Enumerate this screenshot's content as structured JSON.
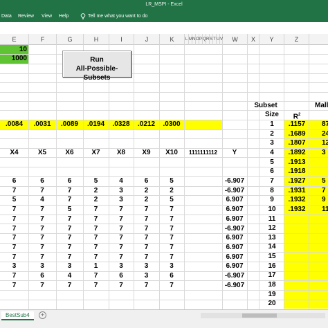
{
  "window": {
    "title": "LR_MSPI  -  Excel"
  },
  "menu": {
    "items": [
      "Data",
      "Review",
      "View",
      "Help"
    ],
    "tell_me": "Tell me what you want to do"
  },
  "columns": [
    "E",
    "F",
    "G",
    "H",
    "I",
    "J",
    "K",
    "L",
    "M",
    "N",
    "O",
    "P",
    "Q",
    "R",
    "S",
    "T",
    "U",
    "V",
    "W",
    "X",
    "Y",
    "Z"
  ],
  "colors": {
    "excel_green": "#217346",
    "cell_green": "#5ec432",
    "highlight_yellow": "#ffff00"
  },
  "sheet": {
    "cell_e1": "10",
    "cell_e2": "1000",
    "run_button": {
      "line1": "Run",
      "line2": "All-Possible-Subsets"
    },
    "prob_row": [
      ".0084",
      ".0031",
      ".0089",
      ".0194",
      ".0328",
      ".0212",
      ".0300"
    ],
    "headers": [
      "X4",
      "X5",
      "X6",
      "X7",
      "X8",
      "X9",
      "X10",
      "1111111112",
      "Y"
    ],
    "data_rows": [
      [
        "6",
        "6",
        "6",
        "5",
        "4",
        "6",
        "5",
        "-6.907"
      ],
      [
        "7",
        "7",
        "7",
        "2",
        "3",
        "2",
        "2",
        "-6.907"
      ],
      [
        "5",
        "4",
        "7",
        "2",
        "3",
        "2",
        "5",
        "6.907"
      ],
      [
        "7",
        "7",
        "5",
        "7",
        "7",
        "7",
        "7",
        "6.907"
      ],
      [
        "7",
        "7",
        "7",
        "7",
        "7",
        "7",
        "7",
        "6.907"
      ],
      [
        "7",
        "7",
        "7",
        "7",
        "7",
        "7",
        "7",
        "-6.907"
      ],
      [
        "7",
        "7",
        "7",
        "7",
        "7",
        "7",
        "7",
        "6.907"
      ],
      [
        "7",
        "7",
        "7",
        "7",
        "7",
        "7",
        "7",
        "6.907"
      ],
      [
        "7",
        "7",
        "7",
        "7",
        "7",
        "7",
        "7",
        "6.907"
      ],
      [
        "3",
        "3",
        "3",
        "1",
        "3",
        "3",
        "3",
        "6.907"
      ],
      [
        "7",
        "6",
        "4",
        "7",
        "6",
        "3",
        "6",
        "-6.907"
      ],
      [
        "7",
        "7",
        "7",
        "7",
        "7",
        "7",
        "7",
        "-6.907"
      ]
    ],
    "subset_header": {
      "line1": "Subset",
      "line2": "Size",
      "r2": "R",
      "r2_sup": "2",
      "mal_partial": "Mall"
    },
    "subset_rows": [
      {
        "size": "1",
        "r2": ".1157",
        "mal": "87"
      },
      {
        "size": "2",
        "r2": ".1689",
        "mal": "24"
      },
      {
        "size": "3",
        "r2": ".1807",
        "mal": "12"
      },
      {
        "size": "4",
        "r2": ".1892",
        "mal": "3"
      },
      {
        "size": "5",
        "r2": ".1913",
        "mal": ""
      },
      {
        "size": "6",
        "r2": ".1918",
        "mal": ""
      },
      {
        "size": "7",
        "r2": ".1927",
        "mal": "5"
      },
      {
        "size": "8",
        "r2": ".1931",
        "mal": "7"
      },
      {
        "size": "9",
        "r2": ".1932",
        "mal": "9"
      },
      {
        "size": "10",
        "r2": ".1932",
        "mal": "11"
      },
      {
        "size": "11",
        "r2": "",
        "mal": ""
      },
      {
        "size": "12",
        "r2": "",
        "mal": ""
      },
      {
        "size": "13",
        "r2": "",
        "mal": ""
      },
      {
        "size": "14",
        "r2": "",
        "mal": ""
      },
      {
        "size": "15",
        "r2": "",
        "mal": ""
      },
      {
        "size": "16",
        "r2": "",
        "mal": ""
      },
      {
        "size": "17",
        "r2": "",
        "mal": ""
      },
      {
        "size": "18",
        "r2": "",
        "mal": ""
      },
      {
        "size": "19",
        "r2": "",
        "mal": ""
      },
      {
        "size": "20",
        "r2": "",
        "mal": ""
      }
    ]
  },
  "statusbar": {
    "sheet_tab": "BestSub4",
    "add_sheet": "+"
  }
}
